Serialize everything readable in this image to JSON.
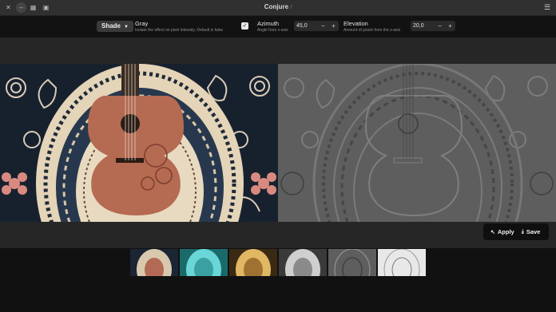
{
  "window": {
    "title": "Conjure",
    "title_icon": "magic-wand-icon"
  },
  "titlebar": {
    "icons": [
      "close-icon",
      "minimize-icon",
      "grid-icon",
      "image-icon"
    ],
    "menu_icon": "hamburger-menu-icon"
  },
  "toolbar": {
    "effect_selector": "Shade",
    "gray": {
      "title": "Gray",
      "subtitle": "Isolate the effect on pixel intensity. Default is false",
      "checked": true
    },
    "azimuth": {
      "title": "Azimuth",
      "subtitle": "Angle from x-axis",
      "value": "45,0",
      "decrement": "−",
      "increment": "+"
    },
    "elevation": {
      "title": "Elevation",
      "subtitle": "Amount of pixels from the z-axis",
      "value": "20,0",
      "decrement": "−",
      "increment": "+"
    }
  },
  "actions": {
    "apply_label": "Apply",
    "apply_icon": "wand-icon",
    "save_label": "Save",
    "save_icon": "download-icon"
  },
  "thumbnails": [
    {
      "name": "original"
    },
    {
      "name": "cyan"
    },
    {
      "name": "sepia"
    },
    {
      "name": "grayscale"
    },
    {
      "name": "shade"
    },
    {
      "name": "sketch"
    }
  ],
  "colors": {
    "accent": "#ffffff",
    "background": "#1b1b1b",
    "toolbar": "#121212"
  }
}
